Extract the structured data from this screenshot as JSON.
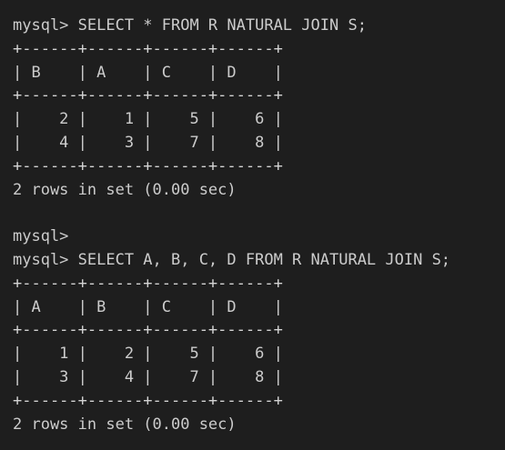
{
  "colors": {
    "background": "#1e1e1e",
    "text": "#cccccc"
  },
  "lines": [
    "mysql> SELECT * FROM R NATURAL JOIN S;",
    "+------+------+------+------+",
    "| B    | A    | C    | D    |",
    "+------+------+------+------+",
    "|    2 |    1 |    5 |    6 |",
    "|    4 |    3 |    7 |    8 |",
    "+------+------+------+------+",
    "2 rows in set (0.00 sec)",
    "",
    "mysql>",
    "mysql> SELECT A, B, C, D FROM R NATURAL JOIN S;",
    "+------+------+------+------+",
    "| A    | B    | C    | D    |",
    "+------+------+------+------+",
    "|    1 |    2 |    5 |    6 |",
    "|    3 |    4 |    7 |    8 |",
    "+------+------+------+------+",
    "2 rows in set (0.00 sec)"
  ]
}
